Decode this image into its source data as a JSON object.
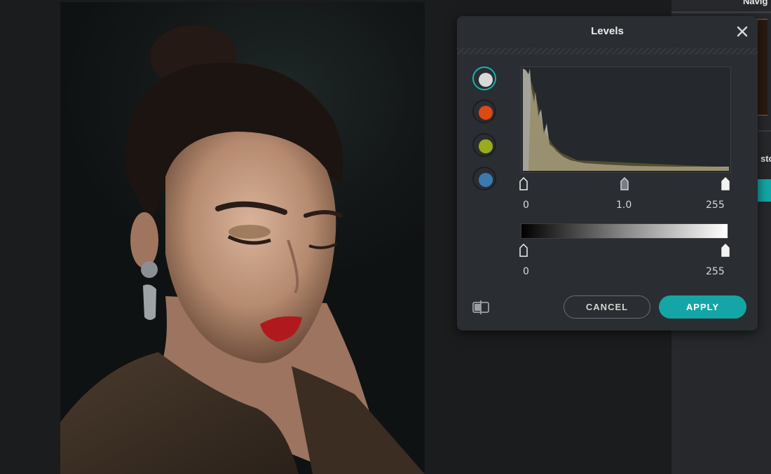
{
  "side_panel": {
    "navigator_title": "Navig",
    "section_label": "sto"
  },
  "levels": {
    "title": "Levels",
    "close_icon": "close-icon",
    "channels": [
      {
        "name": "rgb",
        "color": "#d9d9d9",
        "selected": true
      },
      {
        "name": "red",
        "color": "#d94a14",
        "selected": false
      },
      {
        "name": "green",
        "color": "#9aab1e",
        "selected": false
      },
      {
        "name": "blue",
        "color": "#3a7ab3",
        "selected": false
      }
    ],
    "input": {
      "black_label": "0",
      "gamma_label": "1.0",
      "white_label": "255"
    },
    "output": {
      "black_label": "0",
      "white_label": "255"
    },
    "compare_icon": "split-compare-icon",
    "cancel_label": "CANCEL",
    "apply_label": "APPLY",
    "accent_color": "#14a5a6"
  }
}
